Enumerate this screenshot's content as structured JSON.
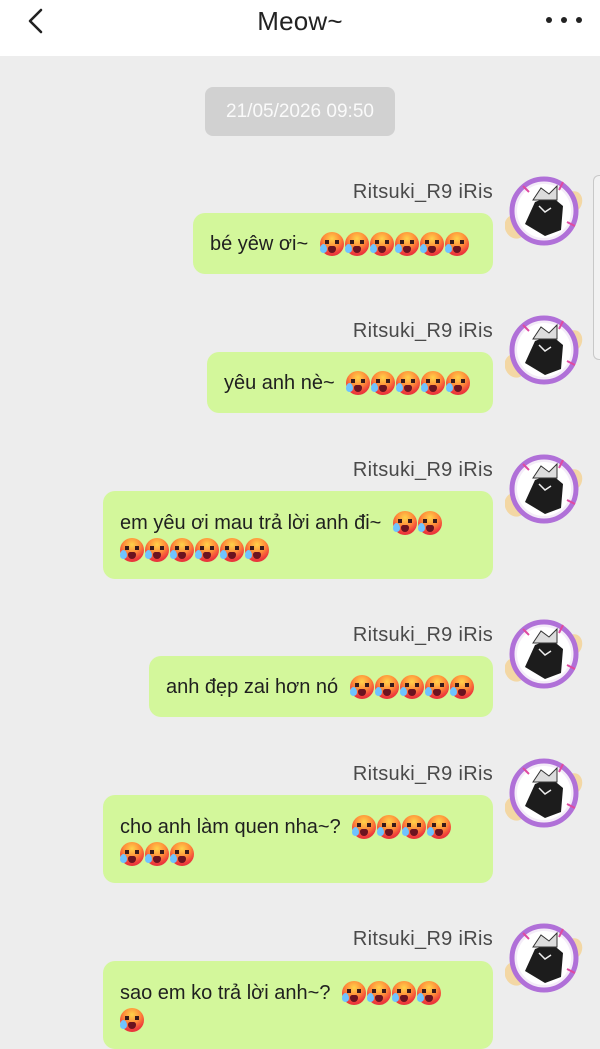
{
  "header": {
    "title": "Meow~"
  },
  "timestamp": "21/05/2026 09:50",
  "icons": {
    "back": "chevron-left-icon",
    "more": "more-dots-icon",
    "emoji": "hot-face-emoji"
  },
  "colors": {
    "bubble": "#d3f79b",
    "background": "#ededed",
    "timestamp_bg": "#d1d1d1"
  },
  "messages": [
    {
      "sender": "Ritsuki_R9 iRis",
      "line1": "bé yêw ơi~ ",
      "line1_emojis": 6,
      "line2": "",
      "line2_emojis": 0
    },
    {
      "sender": "Ritsuki_R9 iRis",
      "line1": "yêu anh nè~ ",
      "line1_emojis": 5,
      "line2": "",
      "line2_emojis": 0
    },
    {
      "sender": "Ritsuki_R9 iRis",
      "line1": "em yêu ơi mau trả lời anh đi~ ",
      "line1_emojis": 2,
      "line2": "",
      "line2_emojis": 6
    },
    {
      "sender": "Ritsuki_R9 iRis",
      "line1": "anh đẹp zai hơn nó ",
      "line1_emojis": 5,
      "line2": "",
      "line2_emojis": 0
    },
    {
      "sender": "Ritsuki_R9 iRis",
      "line1": "cho anh làm quen nha~? ",
      "line1_emojis": 4,
      "line2": "",
      "line2_emojis": 3
    },
    {
      "sender": "Ritsuki_R9 iRis",
      "line1": "sao em ko trả lời anh~? ",
      "line1_emojis": 4,
      "line2": "",
      "line2_emojis": 1
    }
  ]
}
